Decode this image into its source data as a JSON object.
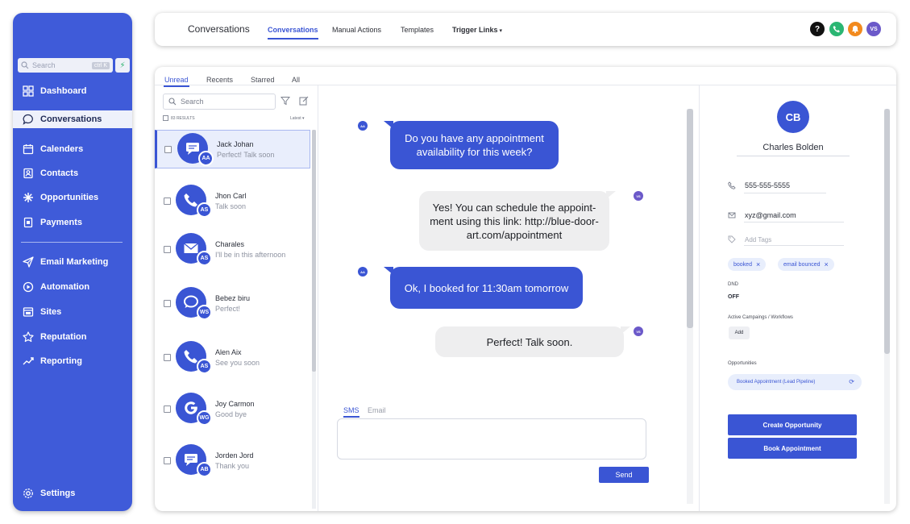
{
  "sidebar": {
    "search_placeholder": "Search",
    "search_shortcut": "ctrl K",
    "items": [
      {
        "label": "Dashboard",
        "icon": "dashboard-icon"
      },
      {
        "label": "Conversations",
        "icon": "chat-icon",
        "active": true
      },
      {
        "label": "Calenders",
        "icon": "calendar-icon"
      },
      {
        "label": "Contacts",
        "icon": "contacts-icon"
      },
      {
        "label": "Opportunities",
        "icon": "opportunities-icon"
      },
      {
        "label": "Payments",
        "icon": "payments-icon"
      },
      {
        "label": "Email Marketing",
        "icon": "send-icon"
      },
      {
        "label": "Automation",
        "icon": "automation-icon"
      },
      {
        "label": "Sites",
        "icon": "sites-icon"
      },
      {
        "label": "Reputation",
        "icon": "star-icon"
      },
      {
        "label": "Reporting",
        "icon": "trend-icon"
      }
    ],
    "settings_label": "Settings"
  },
  "topbar": {
    "title": "Conversations",
    "tabs": [
      "Conversations",
      "Manual Actions",
      "Templates",
      "Trigger Links"
    ],
    "user_initials": "VS",
    "help_label": "?"
  },
  "list": {
    "tabs": [
      "Unread",
      "Recents",
      "Starred",
      "All"
    ],
    "search_placeholder": "Search",
    "results_text": "83 RESULTS",
    "sort_label": "Latest",
    "conversations": [
      {
        "name": "Jack Johan",
        "message": "Perfect! Talk soon",
        "initials": "AA",
        "icon": "message-icon"
      },
      {
        "name": "Jhon Carl",
        "message": "Talk soon",
        "initials": "AS",
        "icon": "phone-icon"
      },
      {
        "name": "Charales",
        "message": "I'll be in this afternoon",
        "initials": "AS",
        "icon": "mail-icon"
      },
      {
        "name": "Bebez biru",
        "message": "Perfect!",
        "initials": "WS",
        "icon": "speech-bubble-icon"
      },
      {
        "name": "Alen Aix",
        "message": "See you soon",
        "initials": "AS",
        "icon": "phone-icon"
      },
      {
        "name": "Joy Carmon",
        "message": "Good bye",
        "initials": "WG",
        "icon": "google-icon"
      },
      {
        "name": "Jorden Jord",
        "message": "Thank you",
        "initials": "AB",
        "icon": "message-icon"
      }
    ]
  },
  "chat": {
    "messages": [
      {
        "direction": "out",
        "text": "Do you have any appointment availability for this week?",
        "avatar": "AA"
      },
      {
        "direction": "in",
        "text": "Yes! You can schedule the appoint-ment using this link: http://blue-door-art.com/appointment",
        "avatar": "VS"
      },
      {
        "direction": "out",
        "text": "Ok, I booked for 11:30am tomorrow",
        "avatar": "AA"
      },
      {
        "direction": "in",
        "text": "Perfect! Talk soon.",
        "avatar": "VS"
      }
    ],
    "compose_tabs": [
      "SMS",
      "Email"
    ],
    "send_label": "Send"
  },
  "contact": {
    "initials": "CB",
    "name": "Charles Bolden",
    "phone": "555-555-5555",
    "email": "xyz@gmail.com",
    "tags_placeholder": "Add Tags",
    "tags": [
      "booked",
      "email bounced"
    ],
    "dnd_label": "DND",
    "dnd_value": "OFF",
    "campaigns_label": "Active Campaings / Workflows",
    "add_label": "Add",
    "opportunities_label": "Opportunities",
    "opportunity": "Booked Appointment (Lead Pipeline)",
    "create_opportunity_label": "Create Opportunity",
    "book_appointment_label": "Book Appointment"
  },
  "colors": {
    "accent": "#3f5bd9",
    "help_icon": "#111111",
    "phone_icon": "#2bb673",
    "bell_icon": "#f28a1e",
    "user_badge": "#6b59c9"
  }
}
